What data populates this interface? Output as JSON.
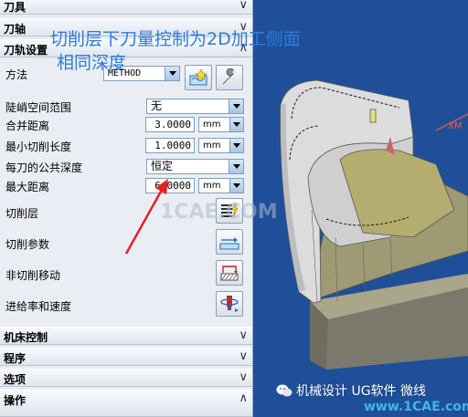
{
  "sections": {
    "tool": {
      "label": "刀具"
    },
    "axis": {
      "label": "刀轴"
    },
    "path_settings": {
      "label": "刀轨设置"
    },
    "machine_control": {
      "label": "机床控制"
    },
    "program": {
      "label": "程序"
    },
    "options": {
      "label": "选项"
    },
    "operation": {
      "label": "操作"
    }
  },
  "path_settings": {
    "method": {
      "label": "方法",
      "value": "METHOD"
    },
    "steep_range": {
      "label": "陡峭空间范围",
      "value": "无"
    },
    "merge_distance": {
      "label": "合并距离",
      "value": "3.0000",
      "unit": "mm"
    },
    "min_cut_length": {
      "label": "最小切削长度",
      "value": "1.0000",
      "unit": "mm"
    },
    "common_depth": {
      "label": "每刀的公共深度",
      "value": "恒定"
    },
    "max_distance": {
      "label": "最大距离",
      "value": "6.0000",
      "unit": "mm"
    },
    "cut_levels": {
      "label": "切削层"
    },
    "cut_params": {
      "label": "切削参数"
    },
    "non_cutting": {
      "label": "非切削移动"
    },
    "feeds_speeds": {
      "label": "进给率和速度"
    }
  },
  "annotation": {
    "line1": "切削层下刀量控制为2D加工侧面",
    "line2": "相同深度"
  },
  "view": {
    "axis_label": "XM",
    "watermark_text": "机械设计 UG软件 微线",
    "watermark_site": "www.1CAE.com",
    "center_watermark": "1CAE.COM"
  },
  "colors": {
    "annotation": "#2f7bd9",
    "arrow": "#e82020",
    "view_background": "#1f4f99",
    "floor": "#9e9a74",
    "wall": "#dcdcdc"
  }
}
